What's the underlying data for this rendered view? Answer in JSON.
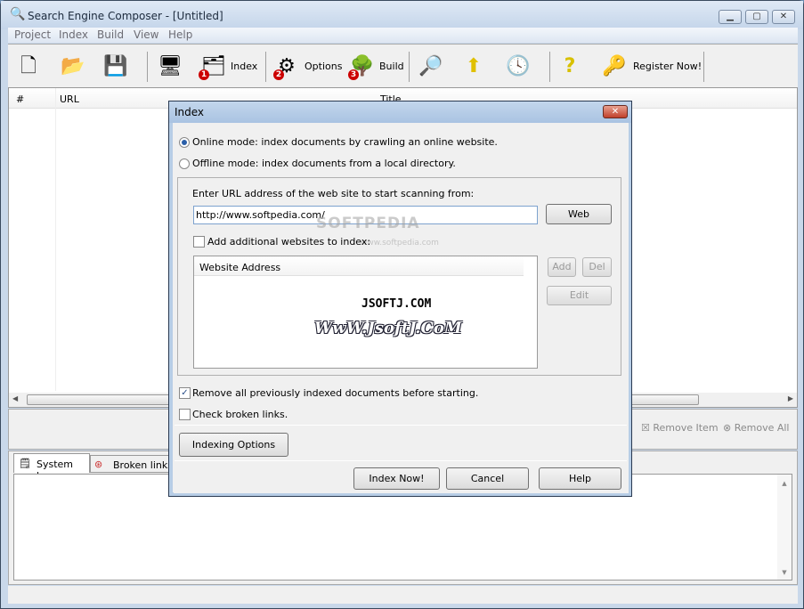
{
  "window": {
    "title": "Search Engine Composer  -  [Untitled]",
    "controls": [
      "minimize",
      "maximize",
      "close"
    ]
  },
  "menu": [
    "Project",
    "Index",
    "Build",
    "View",
    "Help"
  ],
  "toolbar": {
    "index": "Index",
    "options": "Options",
    "build": "Build",
    "register": "Register Now!",
    "badges": [
      "1",
      "2",
      "3"
    ]
  },
  "list": {
    "columns": [
      "#",
      "URL",
      "Title"
    ]
  },
  "panel": {
    "remove_item": "Remove Item",
    "remove_all": "Remove All"
  },
  "tabs": [
    "System log",
    "Broken links r"
  ],
  "dialog": {
    "title": "Index",
    "online": "Online mode: index documents by crawling an online website.",
    "offline": "Offline mode: index documents from a local directory.",
    "url_label": "Enter URL address of the web site to start scanning from:",
    "url_value": "http://www.softpedia.com/",
    "web": "Web",
    "additional": "Add additional websites to index:",
    "website_col": "Website Address",
    "add": "Add",
    "del": "Del",
    "edit": "Edit",
    "remove_prev": "Remove all previously indexed documents before starting.",
    "check_broken": "Check broken links.",
    "indexing_options": "Indexing Options",
    "index_now": "Index Now!",
    "cancel": "Cancel",
    "help": "Help"
  },
  "watermarks": {
    "softpedia": "SOFTPEDIA",
    "softpedia_url": "www.softpedia.com",
    "jsoftj": "JSOFTJ.COM",
    "jsoftj2": "WwW.JsoftJ.CoM"
  }
}
